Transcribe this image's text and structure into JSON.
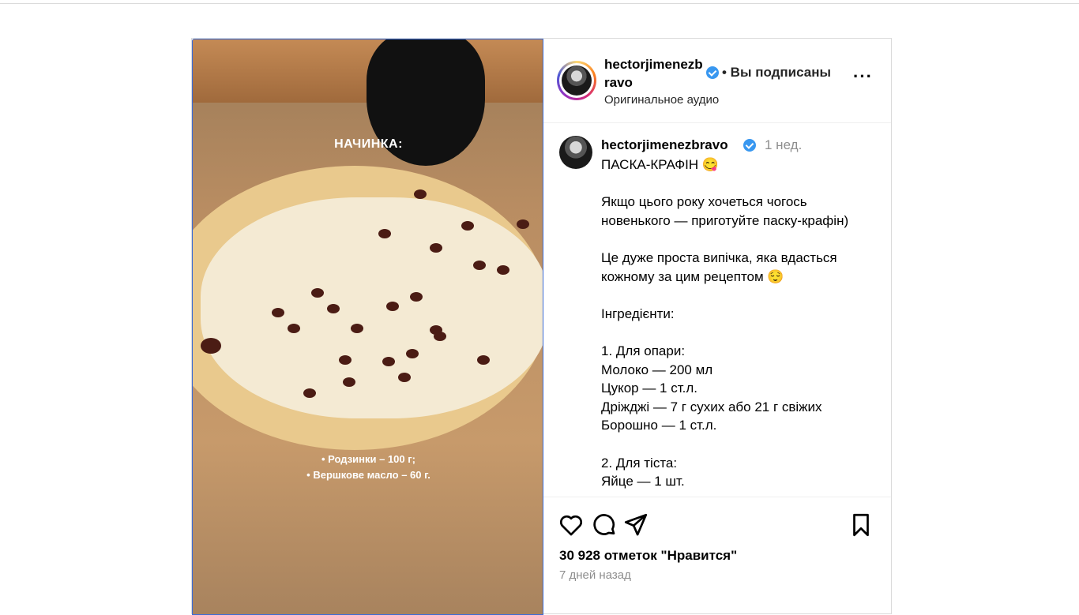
{
  "media": {
    "overlay_title": "НАЧИНКА:",
    "overlay_caption_line1": "• Родзинки – 100 г;",
    "overlay_caption_line2": "• Вершкове масло – 60 г."
  },
  "header": {
    "username": "hectorjimenezbravo",
    "follow_status": "• Вы подписаны",
    "audio": "Оригинальное аудио"
  },
  "comment": {
    "username": "hectorjimenezbravo",
    "time": "1 нед.",
    "text": "ПАСКА-КРАФІН 😋\n\nЯкщо цього року хочеться чогось новенького — приготуйте паску-крафін)\n\nЦе дуже проста випічка, яка вдасться кожному за цим рецептом 😌\n\nІнгредієнти:\n\n1. Для опари:\nМолоко — 200 мл\nЦукор — 1 ст.л.\nДріжджі — 7 г сухих або 21 г свіжих\nБорошно — 1 ст.л.\n\n2. Для тіста:\nЯйце — 1 шт."
  },
  "actions": {
    "likes": "30 928 отметок \"Нравится\"",
    "posted": "7 дней назад"
  },
  "colors": {
    "verified": "#3897f0",
    "border": "#dbdbdb",
    "muted": "#8e8e8e"
  },
  "icons": [
    "more-icon",
    "verified-icon",
    "heart-icon",
    "comment-icon",
    "share-icon",
    "bookmark-icon"
  ]
}
